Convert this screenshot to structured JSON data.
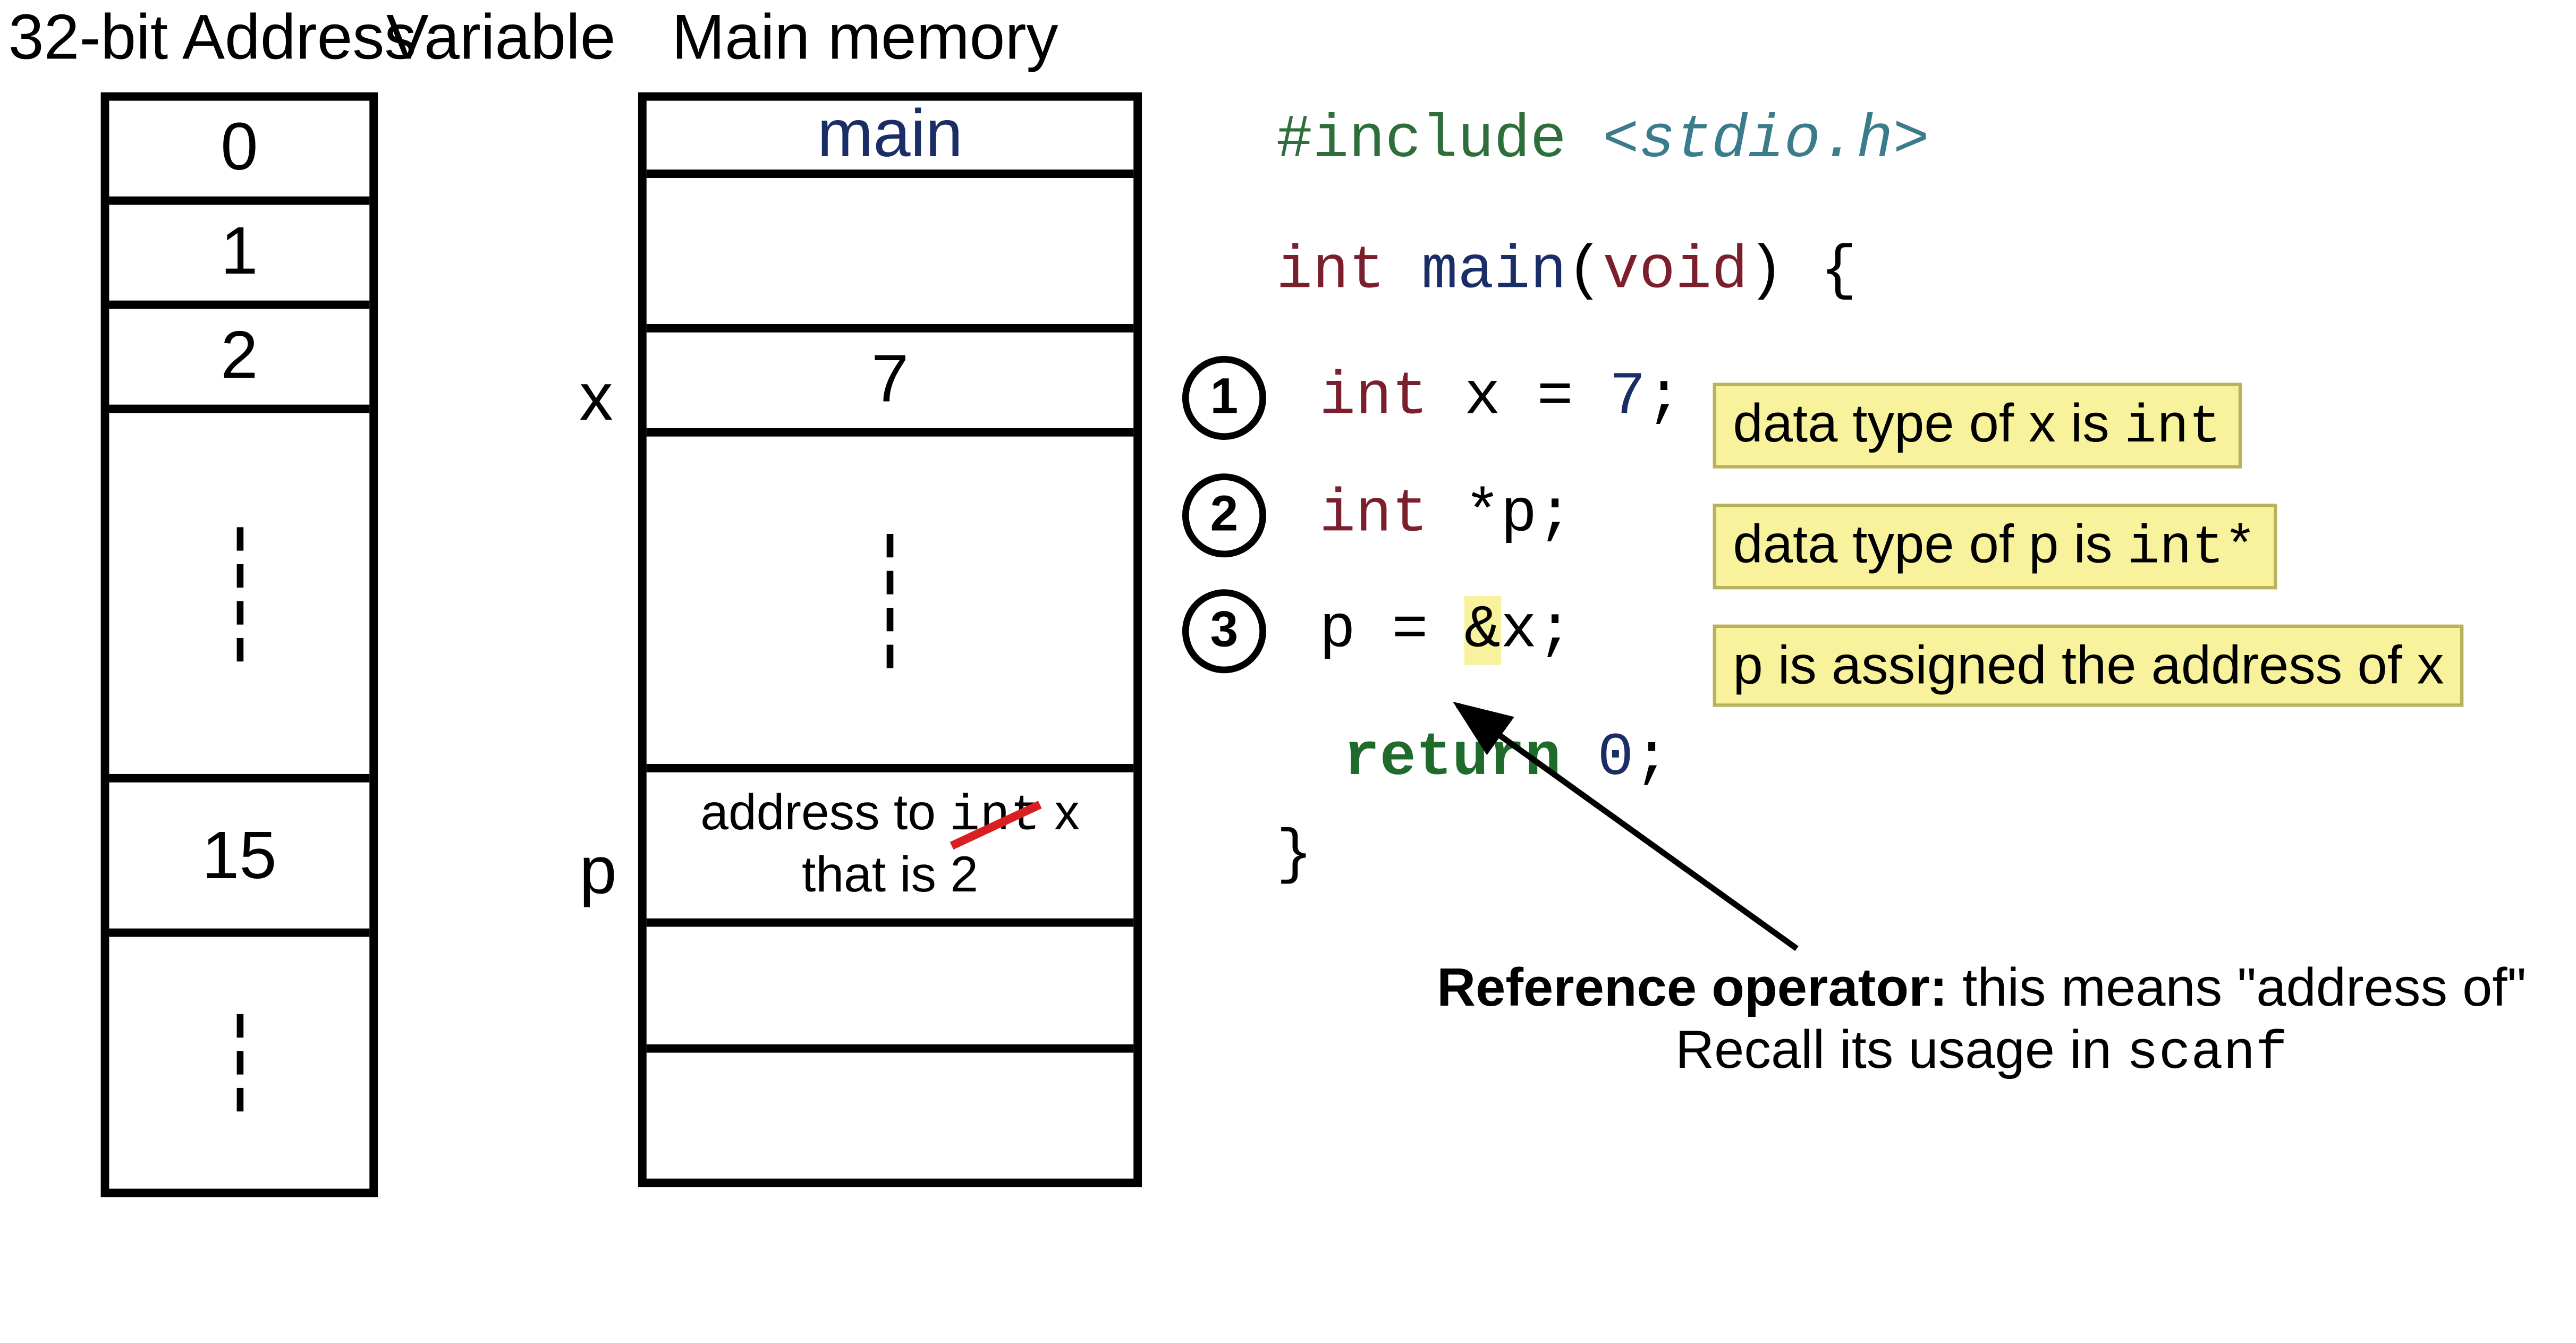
{
  "headers": {
    "addr": "32-bit Address",
    "var": "Variable",
    "mem": "Main memory"
  },
  "address_cells": {
    "a0": "0",
    "a1": "1",
    "a2": "2",
    "a15": "15"
  },
  "variable_labels": {
    "x": "x",
    "p": "p"
  },
  "memory_cells": {
    "main_label": "main",
    "val_x": "7",
    "p_line1_pre": "address to ",
    "p_line1_int": "int",
    "p_line1_post": " x",
    "p_line2": "that is 2"
  },
  "code": {
    "include_kw": "#include ",
    "include_hdr": "<stdio.h>",
    "int_kw": "int ",
    "main_fn": "main",
    "main_args": "(void) {",
    "line1_a": "int ",
    "line1_b": "x = ",
    "line1_num": "7",
    "line1_end": ";",
    "line2_a": "int ",
    "line2_b": "*p;",
    "line3_a": "p = ",
    "line3_amp": "&",
    "line3_b": "x;",
    "return_kw": "return ",
    "return_num": "0",
    "return_end": ";",
    "close": "}"
  },
  "circles": {
    "c1": "1",
    "c2": "2",
    "c3": "3"
  },
  "notes": {
    "n1_pre": "data type of x is ",
    "n1_mono": "int",
    "n2_pre": "data type of p is ",
    "n2_mono": "int*",
    "n3": "p is assigned the address of x"
  },
  "reference_annotation": {
    "bold": "Reference operator:",
    "rest1": " this means \"address of\"",
    "rest2_pre": "Recall its usage in ",
    "rest2_mono": "scanf"
  }
}
